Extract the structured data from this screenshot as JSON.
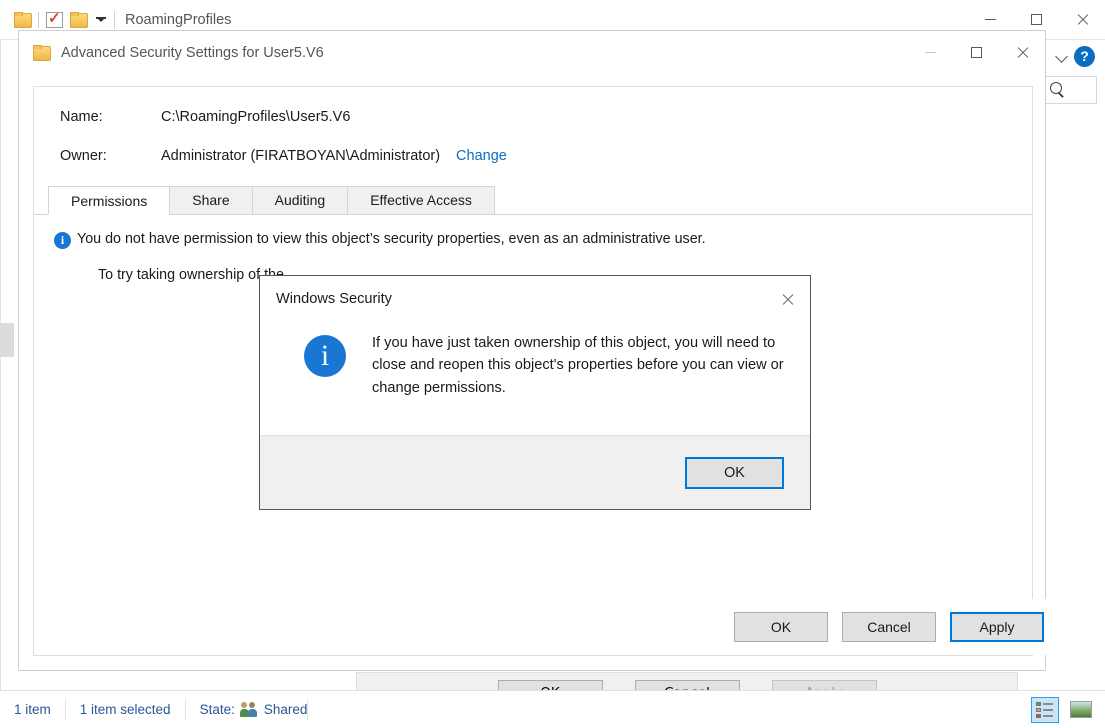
{
  "explorer": {
    "title": "RoamingProfiles",
    "quick_access": [
      "folder-icon",
      "properties-checkbox-icon",
      "folder-icon",
      "customize-caret-icon"
    ],
    "window_controls": {
      "minimize": "minimize-icon",
      "maximize": "maximize-icon",
      "close": "close-icon"
    },
    "ribbon": {
      "expand": "chevron-down-icon",
      "help": "?"
    },
    "search": {
      "icon": "search-icon"
    },
    "statusbar": {
      "item_count": "1 item",
      "selection": "1 item selected",
      "state_label": "State:",
      "state_value": "Shared",
      "views": {
        "details": "details-view-icon",
        "large_icons": "large-icons-view-icon"
      }
    }
  },
  "advanced_security": {
    "title": "Advanced Security Settings for User5.V6",
    "window_controls": {
      "minimize": "minimize-icon",
      "maximize": "maximize-icon",
      "close": "close-icon"
    },
    "fields": [
      {
        "label": "Name:",
        "value": "C:\\RoamingProfiles\\User5.V6"
      },
      {
        "label": "Owner:",
        "value": "Administrator (FIRATBOYAN\\Administrator)",
        "link": "Change"
      }
    ],
    "tabs": [
      {
        "label": "Permissions",
        "active": true
      },
      {
        "label": "Share",
        "active": false
      },
      {
        "label": "Auditing",
        "active": false
      },
      {
        "label": "Effective Access",
        "active": false
      }
    ],
    "permissions_pane": {
      "info_icon": "i",
      "warning": "You do not have permission to view this object’s security properties, even as an administrative user.",
      "try_text": "To try taking ownership of the"
    },
    "buttons": [
      {
        "label": "OK",
        "focused": false
      },
      {
        "label": "Cancel",
        "focused": false
      },
      {
        "label": "Apply",
        "focused": true
      }
    ]
  },
  "properties_dialog": {
    "buttons": [
      {
        "label": "OK",
        "disabled": false
      },
      {
        "label": "Cancel",
        "disabled": false
      },
      {
        "label": "Apply",
        "disabled": true
      }
    ]
  },
  "modal": {
    "title": "Windows Security",
    "close_icon": "close-icon",
    "info_icon": "i",
    "message": "If you have just taken ownership of this object, you will need to close and reopen this object's properties before you can view or change permissions.",
    "ok_label": "OK"
  },
  "colors": {
    "accent": "#0078d7",
    "link": "#0a6dc2",
    "info_blue": "#1976d2",
    "status_text": "#2a5699",
    "button_face": "#e1e1e1",
    "dialog_face": "#f0f0f0"
  }
}
